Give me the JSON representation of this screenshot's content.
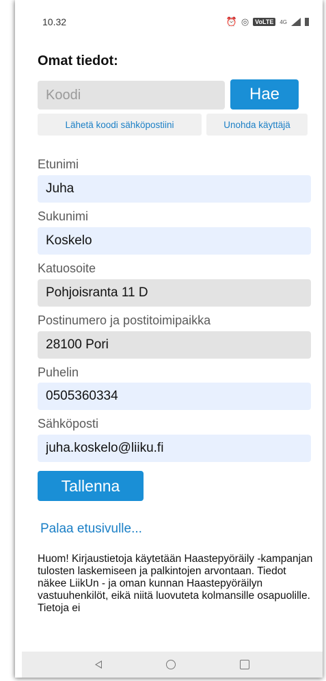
{
  "status_bar": {
    "time": "10.32",
    "volte": "VoLTE",
    "network": "4G",
    "icons": [
      "alarm-icon",
      "hotspot-icon",
      "volte-icon",
      "signal-icon",
      "battery-icon"
    ]
  },
  "page": {
    "heading": "Omat tiedot:"
  },
  "code": {
    "placeholder": "Koodi",
    "search_label": "Hae",
    "send_code_label": "Lähetä koodi sähköpostiini",
    "forget_user_label": "Unohda käyttäjä"
  },
  "form": {
    "first_name_label": "Etunimi",
    "first_name_value": "Juha",
    "last_name_label": "Sukunimi",
    "last_name_value": "Koskelo",
    "street_label": "Katuosoite",
    "street_value": "Pohjoisranta 11 D",
    "postal_label": "Postinumero ja postitoimipaikka",
    "postal_value": "28100 Pori",
    "phone_label": "Puhelin",
    "phone_value": "0505360334",
    "email_label": "Sähköposti",
    "email_value": "juha.koskelo@liiku.fi",
    "save_label": "Tallenna"
  },
  "back_link": "Palaa etusivulle...",
  "notice": "Huom! Kirjaustietoja käytetään Haastepyöräily -kampanjan tulosten laskemiseen ja palkintojen arvontaan. Tiedot näkee LiikUn - ja oman kunnan Haastepyöräilyn vastuuhenkilöt, eikä niitä luovuteta kolmansille osapuolille. Tietoja ei",
  "colors": {
    "accent": "#1a8fd6",
    "link": "#1a7fc6",
    "field_blue": "#e8f0fe",
    "field_grey": "#e3e3e3"
  }
}
